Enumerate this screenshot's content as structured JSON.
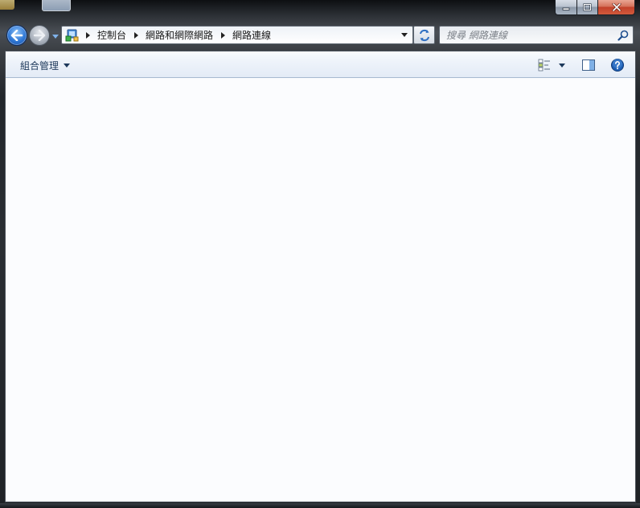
{
  "window": {
    "controls": {
      "minimize_icon": "minimize-icon",
      "maximize_icon": "maximize-icon",
      "close_icon": "close-icon"
    }
  },
  "navigation": {
    "back_icon": "back-arrow-icon",
    "forward_icon": "forward-arrow-icon",
    "history_icon": "chevron-down-icon"
  },
  "address_bar": {
    "location_icon": "control-panel-icon",
    "breadcrumbs": [
      {
        "label": "控制台"
      },
      {
        "label": "網路和網際網路"
      },
      {
        "label": "網路連線"
      }
    ],
    "dropdown_icon": "chevron-down-icon",
    "refresh_icon": "refresh-icon"
  },
  "search": {
    "placeholder": "搜尋 網路連線",
    "value": "",
    "icon": "search-icon"
  },
  "toolbar": {
    "organize_label": "組合管理",
    "views_icon": "change-view-icon",
    "preview_icon": "preview-pane-icon",
    "help_icon": "help-icon"
  },
  "colors": {
    "accent": "#2f78d6",
    "toolbar_text": "#1e395b",
    "help_blue": "#1f5fb4",
    "close_red": "#c2412a"
  }
}
